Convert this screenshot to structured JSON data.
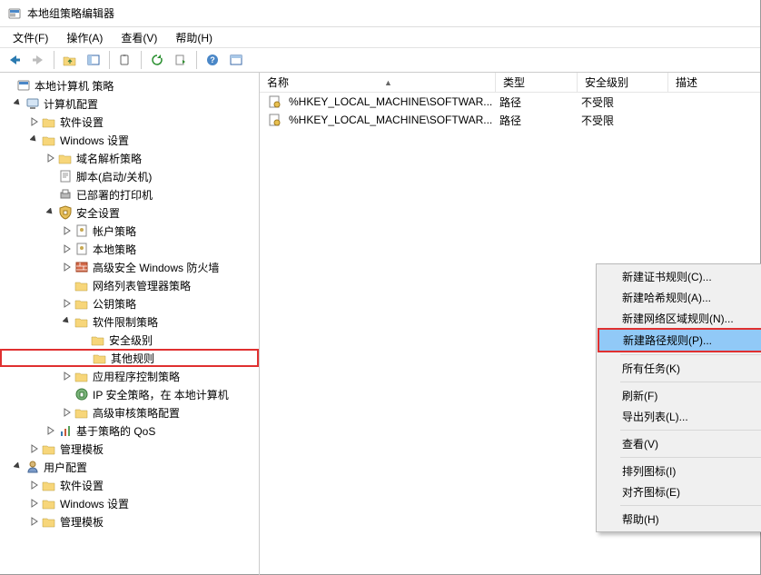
{
  "titlebar": {
    "title": "本地组策略编辑器"
  },
  "menubar": {
    "file": "文件(F)",
    "action": "操作(A)",
    "view": "查看(V)",
    "help": "帮助(H)"
  },
  "tree": {
    "root": "本地计算机 策略",
    "comp_cfg": "计算机配置",
    "soft_set": "软件设置",
    "win_set": "Windows 设置",
    "dns_pol": "域名解析策略",
    "script": "脚本(启动/关机)",
    "printer": "已部署的打印机",
    "sec_set": "安全设置",
    "acct_pol": "帐户策略",
    "local_pol": "本地策略",
    "adv_fw": "高级安全 Windows 防火墙",
    "nlm": "网络列表管理器策略",
    "pubkey": "公钥策略",
    "srp": "软件限制策略",
    "sec_lvl": "安全级别",
    "other_rules": "其他规则",
    "app_ctrl": "应用程序控制策略",
    "ip_sec": "IP 安全策略，在 本地计算机",
    "adv_audit": "高级审核策略配置",
    "qos": "基于策略的 QoS",
    "tmpl": "管理模板",
    "user_cfg": "用户配置",
    "u_soft": "软件设置",
    "u_win": "Windows 设置",
    "u_tmpl": "管理模板"
  },
  "columns": {
    "name": "名称",
    "type": "类型",
    "seclevel": "安全级别",
    "desc": "描述"
  },
  "sort_asc": "▲",
  "rows": [
    {
      "name": "%HKEY_LOCAL_MACHINE\\SOFTWAR...",
      "type": "路径",
      "seclevel": "不受限",
      "desc": ""
    },
    {
      "name": "%HKEY_LOCAL_MACHINE\\SOFTWAR...",
      "type": "路径",
      "seclevel": "不受限",
      "desc": ""
    }
  ],
  "context": {
    "new_cert": "新建证书规则(C)...",
    "new_hash": "新建哈希规则(A)...",
    "new_zone": "新建网络区域规则(N)...",
    "new_path": "新建路径规则(P)...",
    "all_tasks": "所有任务(K)",
    "refresh": "刷新(F)",
    "export": "导出列表(L)...",
    "view": "查看(V)",
    "arrange": "排列图标(I)",
    "align": "对齐图标(E)",
    "help": "帮助(H)"
  }
}
